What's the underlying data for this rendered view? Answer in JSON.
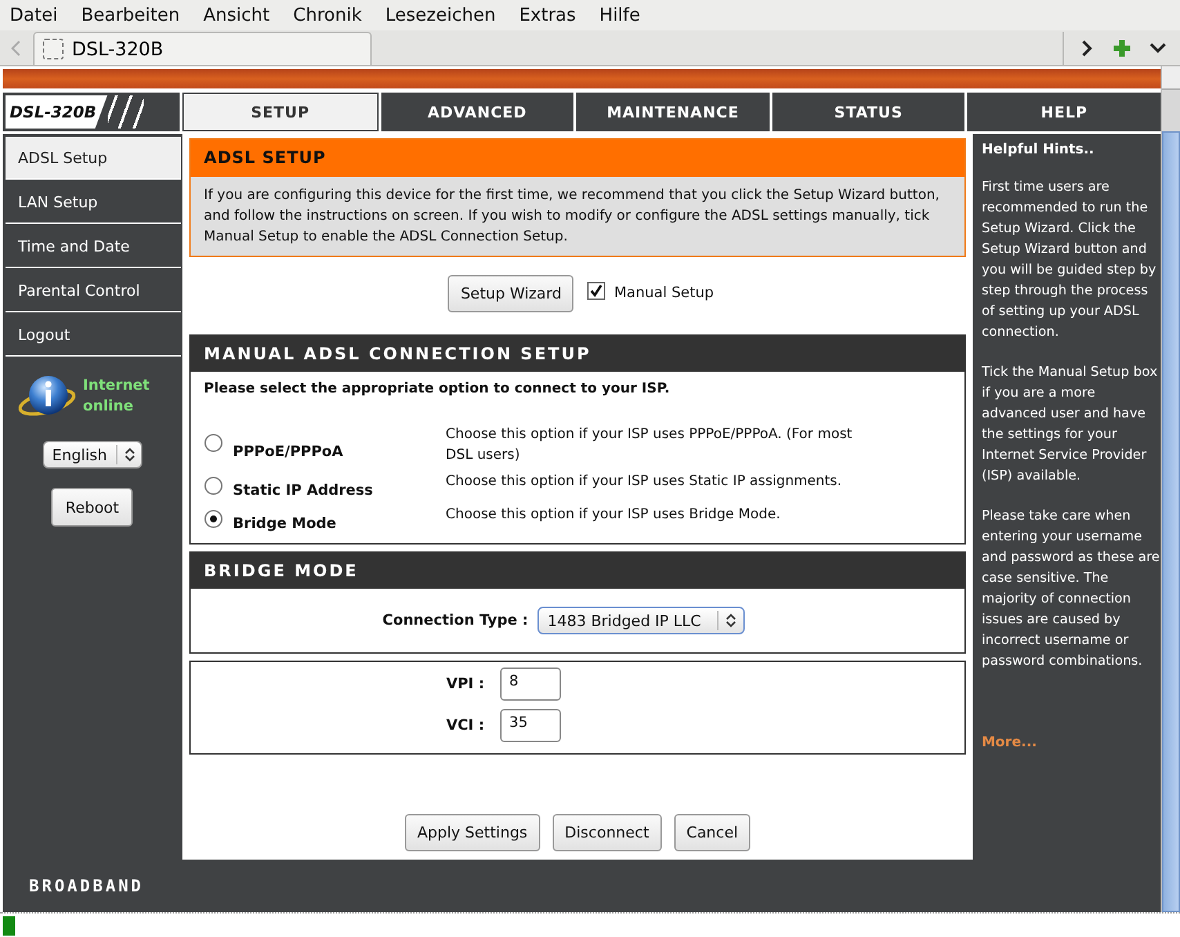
{
  "browser": {
    "menu": [
      "Datei",
      "Bearbeiten",
      "Ansicht",
      "Chronik",
      "Lesezeichen",
      "Extras",
      "Hilfe"
    ],
    "tab": {
      "title": "DSL-320B"
    }
  },
  "header": {
    "model": "DSL-320B"
  },
  "nav": [
    {
      "label": "SETUP",
      "selected": true
    },
    {
      "label": "ADVANCED",
      "selected": false
    },
    {
      "label": "MAINTENANCE",
      "selected": false
    },
    {
      "label": "STATUS",
      "selected": false
    },
    {
      "label": "HELP",
      "selected": false
    }
  ],
  "sidebar": {
    "items": [
      {
        "label": "ADSL Setup",
        "selected": true
      },
      {
        "label": "LAN Setup",
        "selected": false
      },
      {
        "label": "Time and Date",
        "selected": false
      },
      {
        "label": "Parental Control",
        "selected": false
      },
      {
        "label": "Logout",
        "selected": false
      }
    ],
    "status": "Internet online",
    "language": "English",
    "reboot": "Reboot"
  },
  "adsl_setup": {
    "title": "ADSL SETUP",
    "intro": "If you are configuring this device for the first time, we recommend that you click the Setup Wizard button, and follow the instructions on screen. If you wish to modify or configure the ADSL settings manually, tick Manual Setup to enable the ADSL Connection Setup.",
    "wizard_button": "Setup Wizard",
    "manual_setup": {
      "label": "Manual Setup",
      "checked": true
    }
  },
  "manual_connection": {
    "title": "MANUAL ADSL CONNECTION SETUP",
    "prompt": "Please select the appropriate option to connect to your ISP.",
    "options": [
      {
        "label": "PPPoE/PPPoA",
        "description": "Choose this option if your ISP uses PPPoE/PPPoA. (For most DSL users)",
        "selected": false
      },
      {
        "label": "Static IP Address",
        "description": "Choose this option if your ISP uses Static IP assignments.",
        "selected": false
      },
      {
        "label": "Bridge Mode",
        "description": "Choose this option if your ISP uses Bridge Mode.",
        "selected": true
      }
    ]
  },
  "bridge_mode": {
    "title": "BRIDGE MODE",
    "connection_type": {
      "label": "Connection Type :",
      "value": "1483 Bridged IP LLC"
    },
    "fields": [
      {
        "label": "VPI :",
        "value": "8"
      },
      {
        "label": "VCI :",
        "value": "35"
      }
    ]
  },
  "buttons": [
    "Apply Settings",
    "Disconnect",
    "Cancel"
  ],
  "hints": {
    "title": "Helpful Hints..",
    "paragraphs": [
      "First time users are recommended to run the Setup Wizard. Click the Setup Wizard button and you will be guided step by step through the process of setting up your ADSL connection.",
      "Tick the Manual Setup box if you are a more advanced user and have the settings for your Internet Service Provider (ISP) available.",
      "Please take care when entering your username and password as these are case sensitive. The majority of connection issues are caused by incorrect username or password combinations."
    ],
    "more": "More..."
  },
  "footer": {
    "brand": "BROADBAND"
  }
}
